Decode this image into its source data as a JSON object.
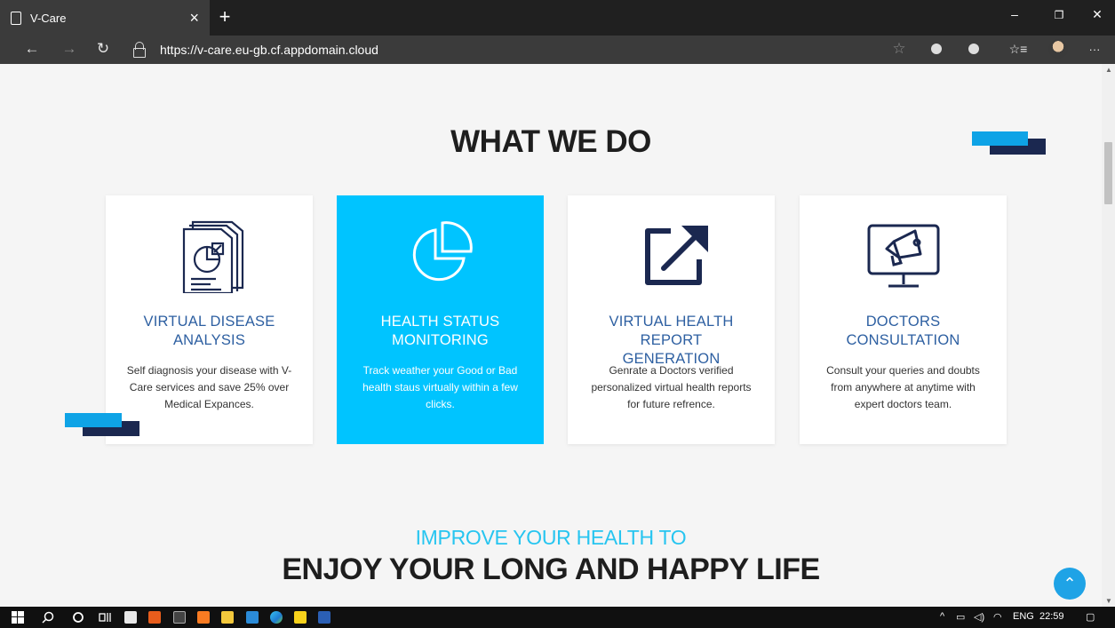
{
  "browser": {
    "tab_title": "V-Care",
    "tab_close": "×",
    "new_tab": "+",
    "url": "https://v-care.eu-gb.cf.appdomain.cloud",
    "win_min": "–",
    "win_restore": "❐",
    "win_close": "✕",
    "back": "←",
    "forward": "→",
    "refresh": "↻",
    "favorite": "☆",
    "favorites_list": "☆≡",
    "more": "···"
  },
  "section": {
    "title": "WHAT WE DO"
  },
  "cards": [
    {
      "title": "VIRTUAL DISEASE ANALYSIS",
      "text": "Self diagnosis your disease with V-Care services and save 25% over Medical Expances.",
      "icon": "report-icon"
    },
    {
      "title": "HEALTH STATUS MONITORING",
      "text": "Track weather your Good or Bad health staus virtually within a few clicks.",
      "icon": "pie-chart-icon"
    },
    {
      "title": "VIRTUAL HEALTH REPORT GENERATION",
      "text": "Genrate a Doctors verified personalized virtual health reports for future refrence.",
      "icon": "external-link-icon"
    },
    {
      "title": "DOCTORS CONSULTATION",
      "text": "Consult your queries and doubts from anywhere at anytime with expert doctors team.",
      "icon": "megaphone-monitor-icon"
    }
  ],
  "promo": {
    "subtitle": "IMPROVE YOUR HEALTH TO",
    "tagline": "ENJOY YOUR LONG AND HAPPY LIFE"
  },
  "back_to_top": "⌃",
  "taskbar": {
    "lang": "ENG",
    "time": "22:59"
  },
  "colors": {
    "accent": "#00c4ff",
    "title_blue": "#2d5fa1",
    "deco_light": "#0ea3e6",
    "deco_dark": "#1b2850"
  }
}
